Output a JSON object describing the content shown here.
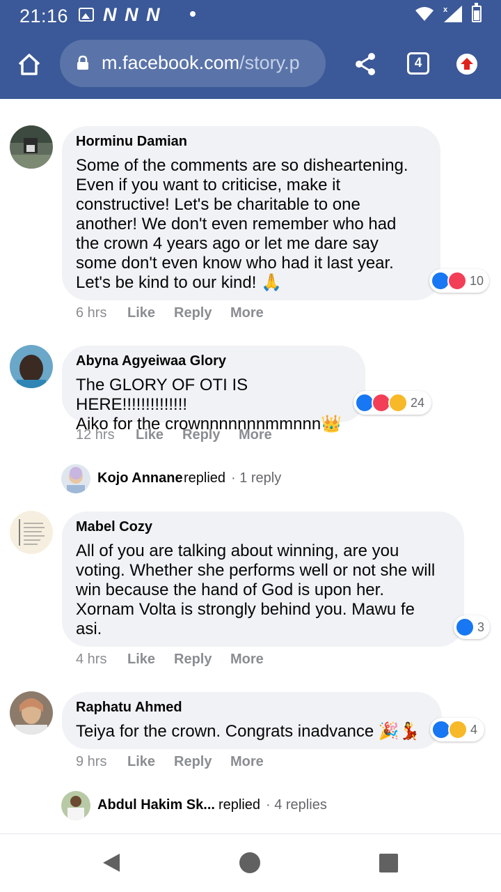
{
  "status_bar": {
    "time": "21:16",
    "notification_letters": "N N N",
    "icons": [
      "image-icon",
      "wifi-icon",
      "signal-icon",
      "battery-icon"
    ]
  },
  "browser": {
    "url_host": "m.facebook.com",
    "url_path": "/story.p",
    "tab_count": "4",
    "icons": [
      "home-icon",
      "lock-icon",
      "share-icon",
      "tabs-icon",
      "upload-icon"
    ]
  },
  "comments": [
    {
      "name": "Horminu Damian",
      "text_lines": [
        "Some of the comments are so disheartening.",
        "Even if you want to criticise, make it",
        "constructive! Let's be charitable to one",
        "another! We don't even remember who had",
        "the crown 4 years ago or let me dare say",
        "some don't even know who had it last year.",
        "Let's be kind to our kind! 🙏"
      ],
      "reaction_count": "10",
      "reactions": [
        "like",
        "love"
      ],
      "time": "6 hrs",
      "actions": {
        "like": "Like",
        "reply": "Reply",
        "more": "More"
      }
    },
    {
      "name": "Abyna Agyeiwaa Glory",
      "text_lines": [
        "The GLORY OF OTI IS HERE!!!!!!!!!!!!!!",
        "Aiko for the crownnnnnnnmmnnn👑"
      ],
      "reaction_count": "24",
      "reactions": [
        "like",
        "love",
        "care"
      ],
      "time": "12 hrs",
      "actions": {
        "like": "Like",
        "reply": "Reply",
        "more": "More"
      },
      "replies": {
        "name": "Kojo Annane",
        "verb": "replied",
        "count": "· 1 reply"
      }
    },
    {
      "name": "Mabel Cozy",
      "text_lines": [
        "All of you are talking about winning, are you",
        "voting. Whether she performs well or not she will",
        "win because the hand of God is upon her.",
        "Xornam Volta is strongly behind you. Mawu fe",
        "asi."
      ],
      "reaction_count": "3",
      "reactions": [
        "like"
      ],
      "time": "4 hrs",
      "actions": {
        "like": "Like",
        "reply": "Reply",
        "more": "More"
      }
    },
    {
      "name": "Raphatu Ahmed",
      "text_lines": [
        "Teiya for the crown. Congrats inadvance 🎉💃"
      ],
      "reaction_count": "4",
      "reactions": [
        "like",
        "haha"
      ],
      "time": "9 hrs",
      "actions": {
        "like": "Like",
        "reply": "Reply",
        "more": "More"
      },
      "replies": {
        "name": "Abdul Hakim Sk...",
        "verb": "replied",
        "count": "· 4 replies"
      }
    }
  ],
  "colors": {
    "header": "#3b5998",
    "bubble": "#f0f2f5",
    "like": "#1877f2",
    "love": "#f33e58",
    "meta_text": "#8a8d91"
  },
  "nav_bar": {
    "icons": [
      "back-icon",
      "home-circle-icon",
      "recents-icon"
    ]
  }
}
